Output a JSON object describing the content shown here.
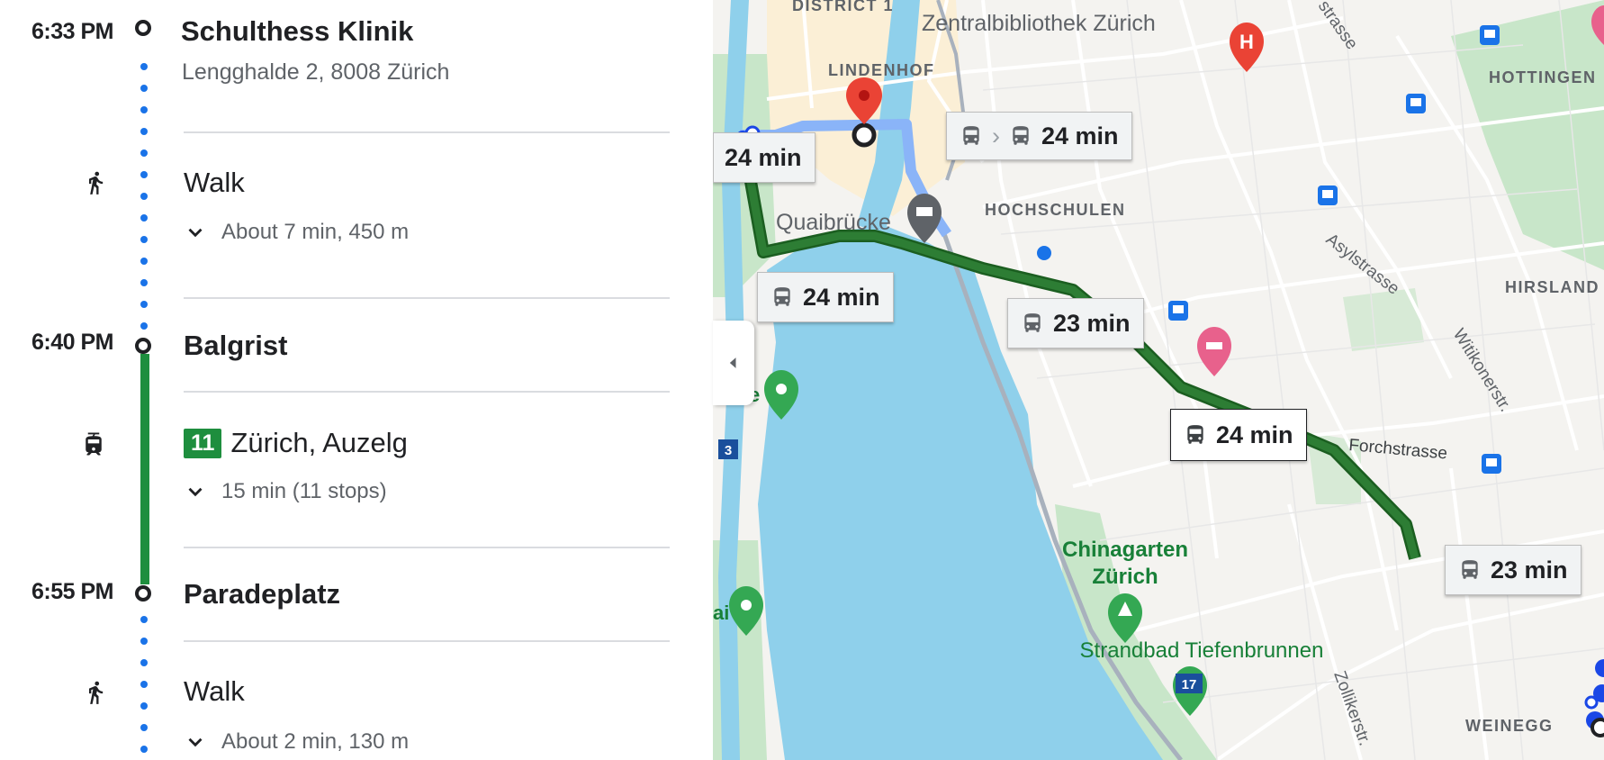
{
  "itinerary": {
    "origin": {
      "time": "6:33 PM",
      "name": "Schulthess Klinik",
      "address": "Lengghalde 2, 8008 Zürich"
    },
    "walk1": {
      "label": "Walk",
      "detail": "About 7 min, 450 m"
    },
    "stop1": {
      "time": "6:40 PM",
      "name": "Balgrist"
    },
    "transit": {
      "line": "11",
      "headsign": "Zürich, Auzelg",
      "detail": "15 min (11 stops)"
    },
    "stop2": {
      "time": "6:55 PM",
      "name": "Paradeplatz"
    },
    "walk2": {
      "label": "Walk",
      "detail": "About 2 min, 130 m"
    }
  },
  "map": {
    "route_labels": {
      "l1": "24 min",
      "l2": "24 min",
      "l3": "24 min",
      "l4": "23 min",
      "l5": "24 min",
      "l6": "23 min"
    },
    "places": {
      "district": "DISTRICT 1",
      "library": "Zentralbibliothek Zürich",
      "lindenhof": "LINDENHOF",
      "hottingen": "HOTTINGEN",
      "quaibruecke": "Quaibrücke",
      "hochschulen": "HOCHSCHULEN",
      "asylstrasse": "Asylstrasse",
      "hirsland": "HIRSLAND",
      "witikonerstr": "Witikonerstr.",
      "forchstrasse": "Forchstrasse",
      "chinagarten1": "Chinagarten",
      "chinagarten2": "Zürich",
      "strandbad": "Strandbad Tiefenbrunnen",
      "zollikerstr": "Zollikerstr.",
      "weinegg": "WEINEGG",
      "strasse": "strasse",
      "edge_e": "e",
      "edge_ai": "ai",
      "shield3": "3",
      "shield17": "17"
    },
    "colors": {
      "route_primary": "#2d7d34",
      "route_alt": "#8ab4f8",
      "water": "#8fd0eb",
      "park": "#c8e6c9",
      "land": "#f4f3f0"
    }
  }
}
